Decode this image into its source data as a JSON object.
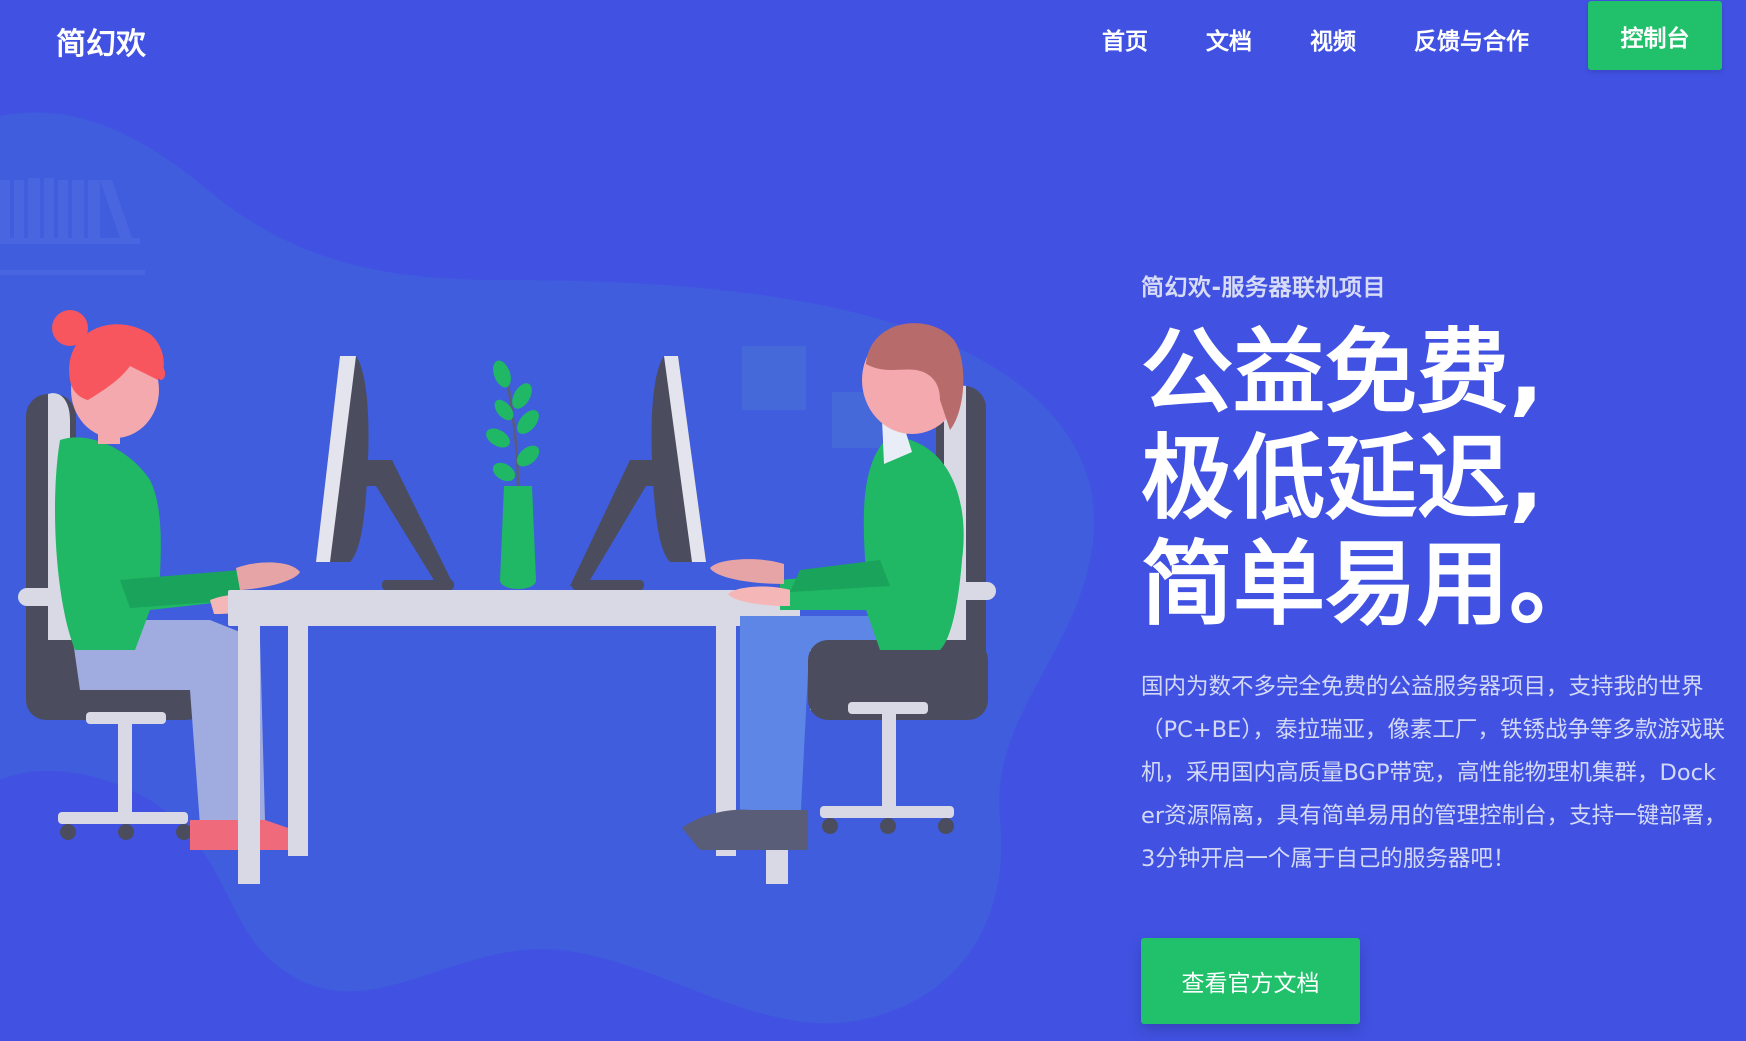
{
  "brand": {
    "name": "简幻欢"
  },
  "nav": {
    "items": [
      {
        "label": "首页"
      },
      {
        "label": "文档"
      },
      {
        "label": "视频"
      },
      {
        "label": "反馈与合作"
      }
    ],
    "console_button": "控制台"
  },
  "hero": {
    "eyebrow": "简幻欢-服务器联机项目",
    "headline_lines": [
      "公益免费,",
      "极低延迟,",
      "简单易用。"
    ],
    "description": "国内为数不多完全免费的公益服务器项目，支持我的世界（PC+BE），泰拉瑞亚，像素工厂，铁锈战争等多款游戏联机，采用国内高质量BGP带宽，高性能物理机集群，Docker资源隔离，具有简单易用的管理控制台，支持一键部署，3分钟开启一个属于自己的服务器吧！",
    "cta_button": "查看官方文档"
  },
  "colors": {
    "background": "#4152e3",
    "accent_green": "#21c16b",
    "blob": "#3f5fdc"
  },
  "illustration": {
    "depicts": "two-people-working-at-desk"
  }
}
